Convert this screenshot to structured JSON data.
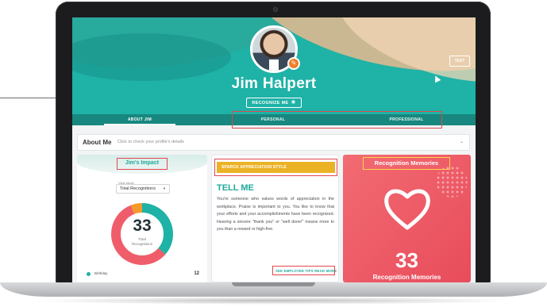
{
  "profile": {
    "name": "Jim Halpert",
    "recognize_label": "RECOGNIZE ME",
    "text_button": "TEXT"
  },
  "tabs": [
    "ABOUT JIM",
    "PERSONAL",
    "PROFESSIONAL"
  ],
  "about": {
    "label": "About Me",
    "hint": "Click to check your profile's details"
  },
  "impact": {
    "title": "Jim's Impact",
    "view_mode_caption": "View Mode",
    "view_mode_value": "Total Recognitions",
    "total": "33",
    "total_caption_line1": "Total",
    "total_caption_line2": "Recognitions",
    "legend": [
      {
        "label": "Birthday",
        "value": "12",
        "color": "#1fb2a6"
      }
    ]
  },
  "appreciation": {
    "badge": "SPARCK APPRECIATION STYLE",
    "heading": "TELL ME",
    "body": "You're someone who values words of appreciation in the workplace. Praise is important to you. You like to know that your efforts and your accomplishments have been recognized. Hearing a sincere \"thank you\" or \"well done!\" means more to you than a reward or high-five.",
    "links": "SEE EMPLOYEE TIPS  READ MORE"
  },
  "memories": {
    "title": "Recognition Memories",
    "count": "33",
    "caption": "Recognition Memories"
  },
  "chart_data": {
    "type": "pie",
    "series": [
      {
        "name": "Birthday",
        "value": 12,
        "color": "#1fb2a6"
      },
      {
        "value": 19,
        "color": "#f05d6a"
      },
      {
        "value": 2,
        "color": "#f39a2a"
      }
    ]
  },
  "colors": {
    "teal": "#1fb2a6",
    "teal_dark": "#17877f",
    "coral": "#f05d6a",
    "gold": "#ebb226",
    "highlight": "#e0484f"
  }
}
